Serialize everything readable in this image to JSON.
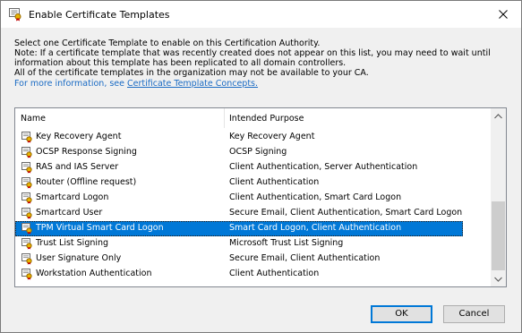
{
  "window": {
    "title": "Enable Certificate Templates"
  },
  "description": {
    "lines": [
      "Select one Certificate Template to enable on this Certification Authority.",
      "Note: If a certificate template that was recently created does not appear on this list, you may need to wait until",
      "information about this template has been replicated to all domain controllers.",
      "All of the certificate templates in the organization may not be available to your CA."
    ],
    "link_prefix": "For more information, see ",
    "link_text": "Certificate Template Concepts."
  },
  "list": {
    "columns": {
      "name": "Name",
      "purpose": "Intended Purpose"
    },
    "rows": [
      {
        "name": "Key Recovery Agent",
        "purpose": "Key Recovery Agent"
      },
      {
        "name": "OCSP Response Signing",
        "purpose": "OCSP Signing"
      },
      {
        "name": "RAS and IAS Server",
        "purpose": "Client Authentication, Server Authentication"
      },
      {
        "name": "Router (Offline request)",
        "purpose": "Client Authentication"
      },
      {
        "name": "Smartcard Logon",
        "purpose": "Client Authentication, Smart Card Logon"
      },
      {
        "name": "Smartcard User",
        "purpose": "Secure Email, Client Authentication, Smart Card Logon"
      },
      {
        "name": "TPM Virtual Smart Card Logon",
        "purpose": "Smart Card Logon, Client Authentication"
      },
      {
        "name": "Trust List Signing",
        "purpose": "Microsoft Trust List Signing"
      },
      {
        "name": "User Signature Only",
        "purpose": "Secure Email, Client Authentication"
      },
      {
        "name": "Workstation Authentication",
        "purpose": "Client Authentication"
      }
    ],
    "selected_index": 6
  },
  "buttons": {
    "ok": "OK",
    "cancel": "Cancel"
  },
  "colors": {
    "selection": "#0078d7",
    "link": "#1a6bc4",
    "accent": "#0078d7"
  },
  "icons": {
    "title": "certificate-icon",
    "row": "certificate-template-icon",
    "close": "close-icon"
  }
}
